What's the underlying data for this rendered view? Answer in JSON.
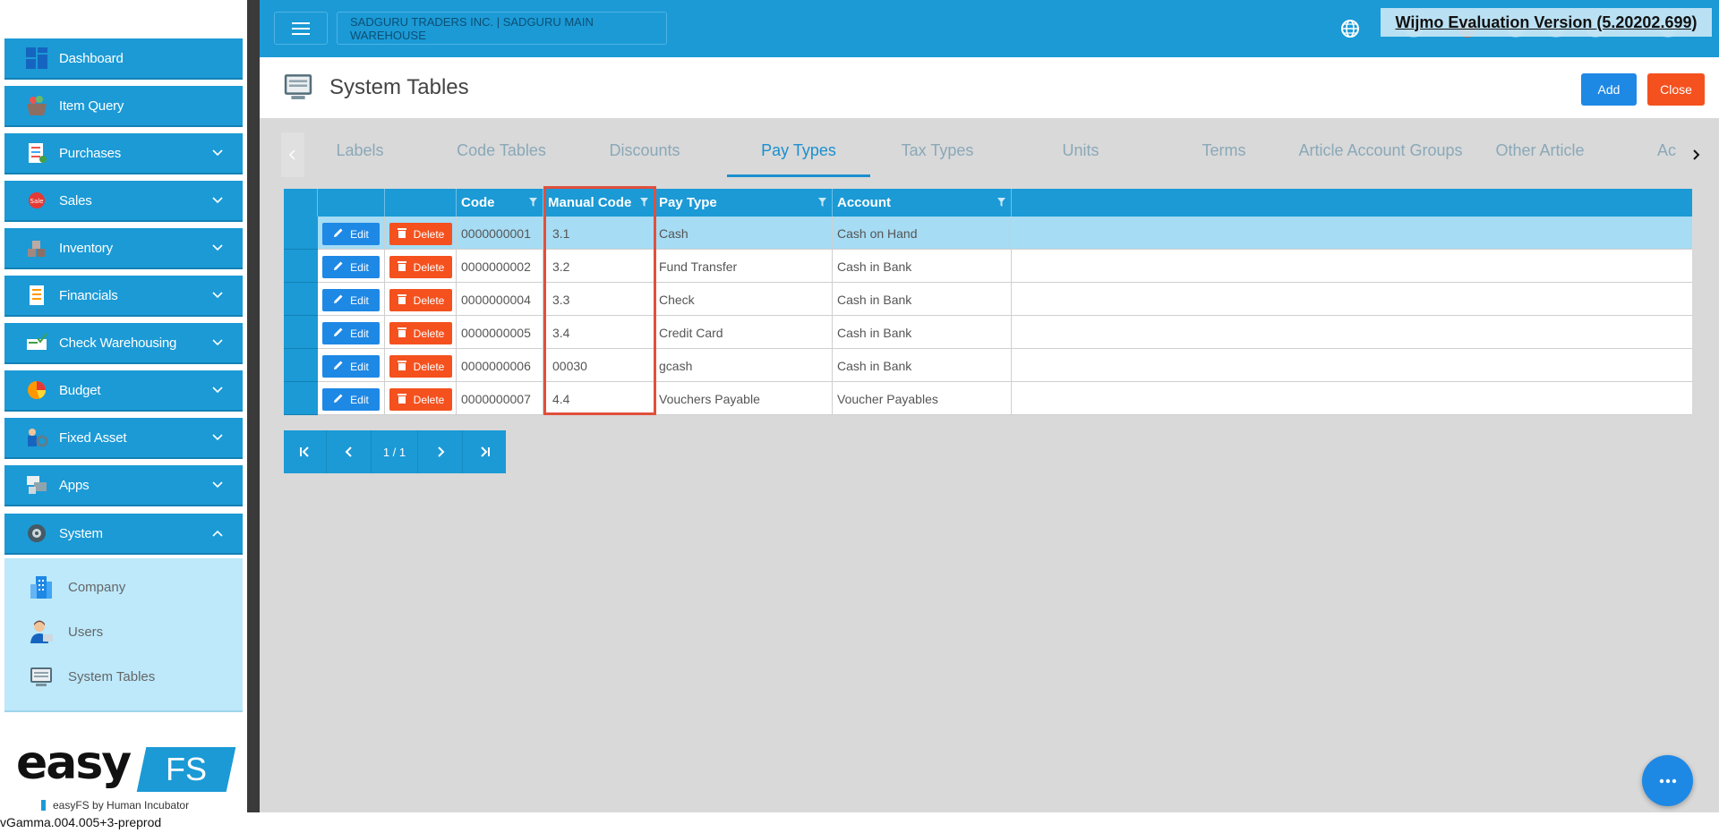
{
  "sidebar": {
    "items": [
      {
        "label": "Dashboard",
        "icon": "dashboard-icon",
        "has_chevron": false
      },
      {
        "label": "Item Query",
        "icon": "basket-icon",
        "has_chevron": false
      },
      {
        "label": "Purchases",
        "icon": "purchase-list-icon",
        "has_chevron": true
      },
      {
        "label": "Sales",
        "icon": "sale-tag-icon",
        "has_chevron": true
      },
      {
        "label": "Inventory",
        "icon": "inventory-boxes-icon",
        "has_chevron": true
      },
      {
        "label": "Financials",
        "icon": "financial-report-icon",
        "has_chevron": true
      },
      {
        "label": "Check Warehousing",
        "icon": "check-icon",
        "has_chevron": true
      },
      {
        "label": "Budget",
        "icon": "budget-pie-icon",
        "has_chevron": true
      },
      {
        "label": "Fixed Asset",
        "icon": "fixed-asset-icon",
        "has_chevron": true
      },
      {
        "label": "Apps",
        "icon": "apps-icon",
        "has_chevron": true
      },
      {
        "label": "System",
        "icon": "system-gear-icon",
        "has_chevron": true,
        "expanded": true
      }
    ],
    "system_subitems": [
      {
        "label": "Company",
        "icon": "company-building-icon"
      },
      {
        "label": "Users",
        "icon": "users-person-icon"
      },
      {
        "label": "System Tables",
        "icon": "system-tables-icon"
      }
    ]
  },
  "brand": {
    "logo_text": "easy",
    "logo_box_text": "FS",
    "tagline": "easyFS by Human Incubator"
  },
  "version": "vGamma.004.005+3-preprod",
  "header": {
    "company": "SADGURU TRADERS INC. | SADGURU MAIN WAREHOUSE",
    "watermark": "Wijmo Evaluation Version (5.20202.699)"
  },
  "page": {
    "title": "System Tables",
    "add_label": "Add",
    "close_label": "Close"
  },
  "tabs": [
    {
      "label": "Labels",
      "active": false
    },
    {
      "label": "Code Tables",
      "active": false
    },
    {
      "label": "Discounts",
      "active": false
    },
    {
      "label": "Pay Types",
      "active": true
    },
    {
      "label": "Tax Types",
      "active": false
    },
    {
      "label": "Units",
      "active": false
    },
    {
      "label": "Terms",
      "active": false
    },
    {
      "label": "Article Account Groups",
      "active": false
    },
    {
      "label": "Other Article",
      "active": false
    },
    {
      "label": "Ac",
      "active": false
    }
  ],
  "grid": {
    "columns": {
      "code": "Code",
      "manual_code": "Manual Code",
      "pay_type": "Pay Type",
      "account": "Account"
    },
    "edit_label": "Edit",
    "delete_label": "Delete",
    "rows": [
      {
        "code": "0000000001",
        "manual_code": "3.1",
        "pay_type": "Cash",
        "account": "Cash on Hand",
        "selected": true
      },
      {
        "code": "0000000002",
        "manual_code": "3.2",
        "pay_type": "Fund Transfer",
        "account": "Cash in Bank",
        "selected": false
      },
      {
        "code": "0000000004",
        "manual_code": "3.3",
        "pay_type": "Check",
        "account": "Cash in Bank",
        "selected": false
      },
      {
        "code": "0000000005",
        "manual_code": "3.4",
        "pay_type": "Credit Card",
        "account": "Cash in Bank",
        "selected": false
      },
      {
        "code": "0000000006",
        "manual_code": "00030",
        "pay_type": "gcash",
        "account": "Cash in Bank",
        "selected": false
      },
      {
        "code": "0000000007",
        "manual_code": "4.4",
        "pay_type": "Vouchers Payable",
        "account": "Voucher Payables",
        "selected": false
      }
    ]
  },
  "pager": {
    "page_text": "1 / 1"
  },
  "colors": {
    "primary": "#1b9ad6",
    "button_blue": "#1e88e5",
    "button_orange": "#f4511e",
    "selected_row": "#a6dcf4",
    "highlight_box": "#e0503d"
  }
}
